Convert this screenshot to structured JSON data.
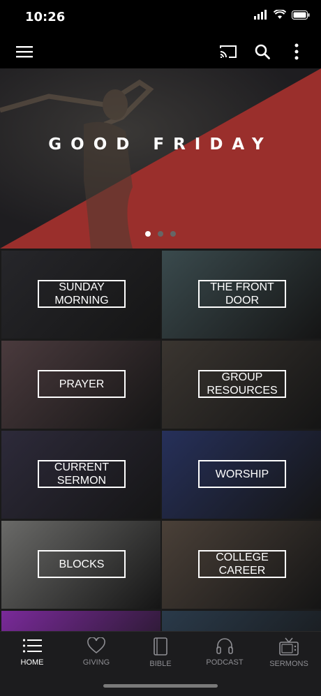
{
  "status": {
    "time": "10:26"
  },
  "hero": {
    "title": "GOOD FRIDAY",
    "slide_count": 3,
    "active_slide": 1
  },
  "tiles": [
    {
      "label": "SUNDAY MORNING",
      "bg": "#26262a"
    },
    {
      "label": "THE FRONT DOOR",
      "bg": "#3a4a4d"
    },
    {
      "label": "PRAYER",
      "bg": "#4a3a3d"
    },
    {
      "label": "GROUP RESOURCES",
      "bg": "#3a3530"
    },
    {
      "label": "CURRENT SERMON",
      "bg": "#2d2a3a"
    },
    {
      "label": "WORSHIP",
      "bg": "#26305a"
    },
    {
      "label": "BLOCKS",
      "bg": "#6a6a68"
    },
    {
      "label": "COLLEGE CAREER",
      "bg": "#4a4038"
    },
    {
      "label": "",
      "bg": "#7a2a9a"
    },
    {
      "label": "",
      "bg": "#2a3a4a"
    }
  ],
  "tabs": [
    {
      "label": "HOME",
      "icon": "list-icon",
      "active": true
    },
    {
      "label": "GIVING",
      "icon": "heart-icon",
      "active": false
    },
    {
      "label": "BIBLE",
      "icon": "book-icon",
      "active": false
    },
    {
      "label": "PODCAST",
      "icon": "headphones-icon",
      "active": false
    },
    {
      "label": "SERMONS",
      "icon": "tv-icon",
      "active": false
    }
  ],
  "colors": {
    "accent_red": "#9a2f2c",
    "background": "#000000",
    "tabbar": "#1c1c1e"
  }
}
